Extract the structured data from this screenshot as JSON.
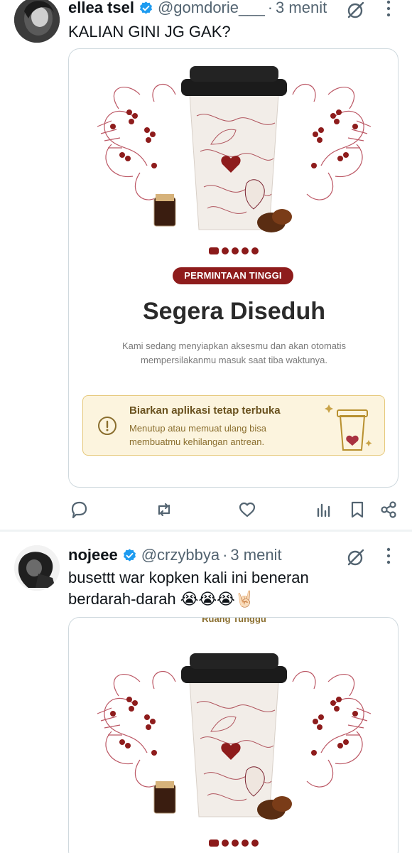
{
  "tweet1": {
    "display_name": "ellea tsel",
    "handle": "@gomdorie___",
    "separator": "·",
    "time": "3 menit",
    "text": "KALIAN GINI JG GAK?",
    "card": {
      "badge": "PERMINTAAN TINGGI",
      "title": "Segera Diseduh",
      "description_line1": "Kami sedang menyiapkan aksesmu dan akan otomatis",
      "description_line2": "mempersilakanmu masuk saat tiba waktunya.",
      "notice_title": "Biarkan aplikasi tetap terbuka",
      "notice_line1": "Menutup atau memuat ulang bisa",
      "notice_line2": "membuatmu kehilangan antrean."
    }
  },
  "tweet2": {
    "display_name": "nojeee",
    "handle": "@crzybbya",
    "separator": "·",
    "time": "3 menit",
    "text_line1": "busettt war kopken kali ini beneran",
    "text_line2": "berdarah-darah 😭😭😭🤘🏻",
    "card": {
      "top_label": "Ruang Tunggu"
    }
  },
  "icons": {
    "verified": "verified-badge-icon",
    "grok": "grok-icon",
    "more": "more-icon",
    "reply": "reply-icon",
    "retweet": "retweet-icon",
    "like": "like-icon",
    "views": "views-icon",
    "bookmark": "bookmark-icon",
    "share": "share-icon"
  },
  "colors": {
    "verified": "#1d9bf0",
    "brand_red": "#8e1c1c",
    "notice_bg": "#fcf4de",
    "notice_border": "#e6c97c",
    "secondary_text": "#536471"
  }
}
